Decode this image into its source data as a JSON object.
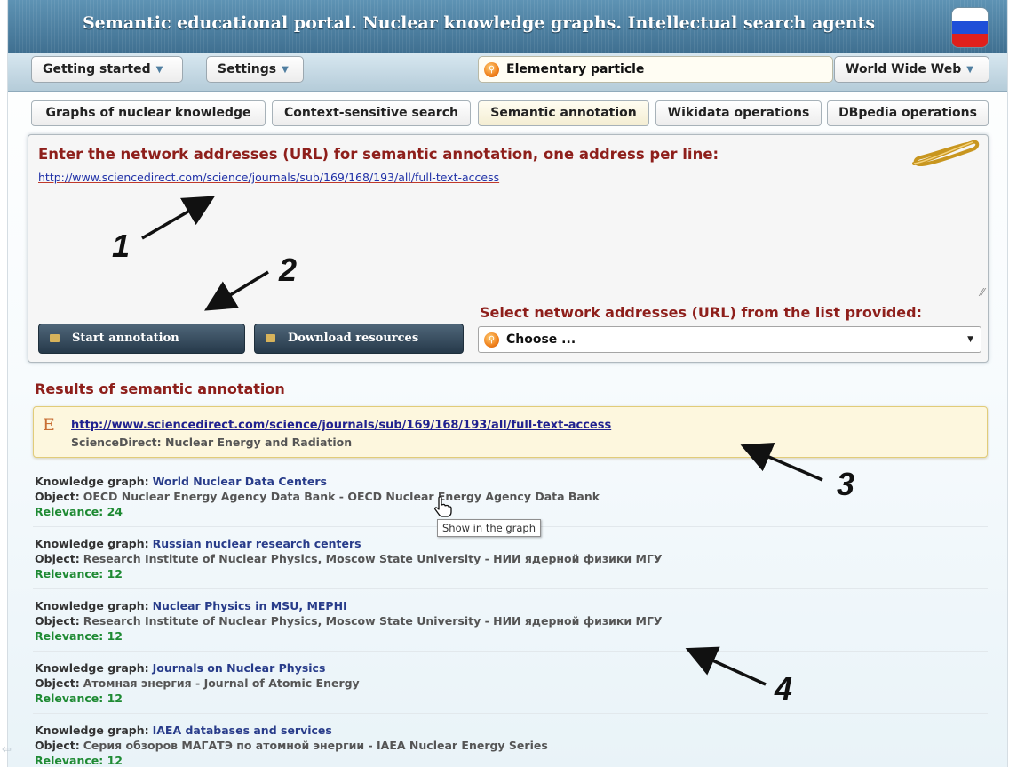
{
  "titlebar": {
    "title": "Semantic educational portal. Nuclear knowledge graphs. Intellectual search agents",
    "flag_icon": "russian-flag-icon",
    "flag_colors": [
      "#ffffff",
      "#1f4fd8",
      "#e0201c"
    ]
  },
  "menubar": {
    "getting_started": "Getting started",
    "settings": "Settings",
    "search_value": "Elementary particle",
    "search_icon": "search-orb-icon",
    "scope": "World Wide Web"
  },
  "tabs": [
    {
      "label": "Graphs of nuclear knowledge",
      "active": false
    },
    {
      "label": "Context-sensitive search",
      "active": false
    },
    {
      "label": "Semantic annotation",
      "active": true
    },
    {
      "label": "Wikidata operations",
      "active": false
    },
    {
      "label": "DBpedia operations",
      "active": false
    }
  ],
  "annotation_panel": {
    "heading": "Enter the network addresses (URL) for semantic annotation, one address per line:",
    "url_text": "http://www.sciencedirect.com/science/journals/sub/169/168/193/all/full-text-access",
    "select_label": "Select network addresses (URL) from the list provided:",
    "start_button": "Start annotation",
    "download_button": "Download resources",
    "choose_value": "Choose ..."
  },
  "results": {
    "heading": "Results of semantic annotation",
    "source": {
      "marker": "E",
      "url": "http://www.sciencedirect.com/science/journals/sub/169/168/193/all/full-text-access",
      "subtitle": "ScienceDirect: Nuclear Energy and Radiation"
    },
    "graph_label": "Knowledge graph:",
    "object_label": "Object:",
    "items": [
      {
        "graph": "World Nuclear Data Centers",
        "object": "OECD Nuclear Energy Agency Data Bank - OECD Nuclear Energy Agency Data Bank",
        "relevance": "Relevance: 24"
      },
      {
        "graph": "Russian nuclear research centers",
        "object": "Research Institute of Nuclear Physics, Moscow State University - НИИ ядерной физики МГУ",
        "relevance": "Relevance: 12"
      },
      {
        "graph": "Nuclear Physics in MSU, MEPHI",
        "object": "Research Institute of Nuclear Physics, Moscow State University - НИИ ядерной физики МГУ",
        "relevance": "Relevance: 12"
      },
      {
        "graph": "Journals on Nuclear Physics",
        "object": "Атомная энергия - Journal of Atomic Energy",
        "relevance": "Relevance: 12"
      },
      {
        "graph": "IAEA databases and services",
        "object": "Серия обзоров МАГАТЭ по атомной энергии - IAEA Nuclear Energy Series",
        "relevance": "Relevance: 12"
      }
    ],
    "tooltip": "Show in the graph"
  },
  "annotations": {
    "n1": "1",
    "n2": "2",
    "n3": "3",
    "n4": "4"
  }
}
